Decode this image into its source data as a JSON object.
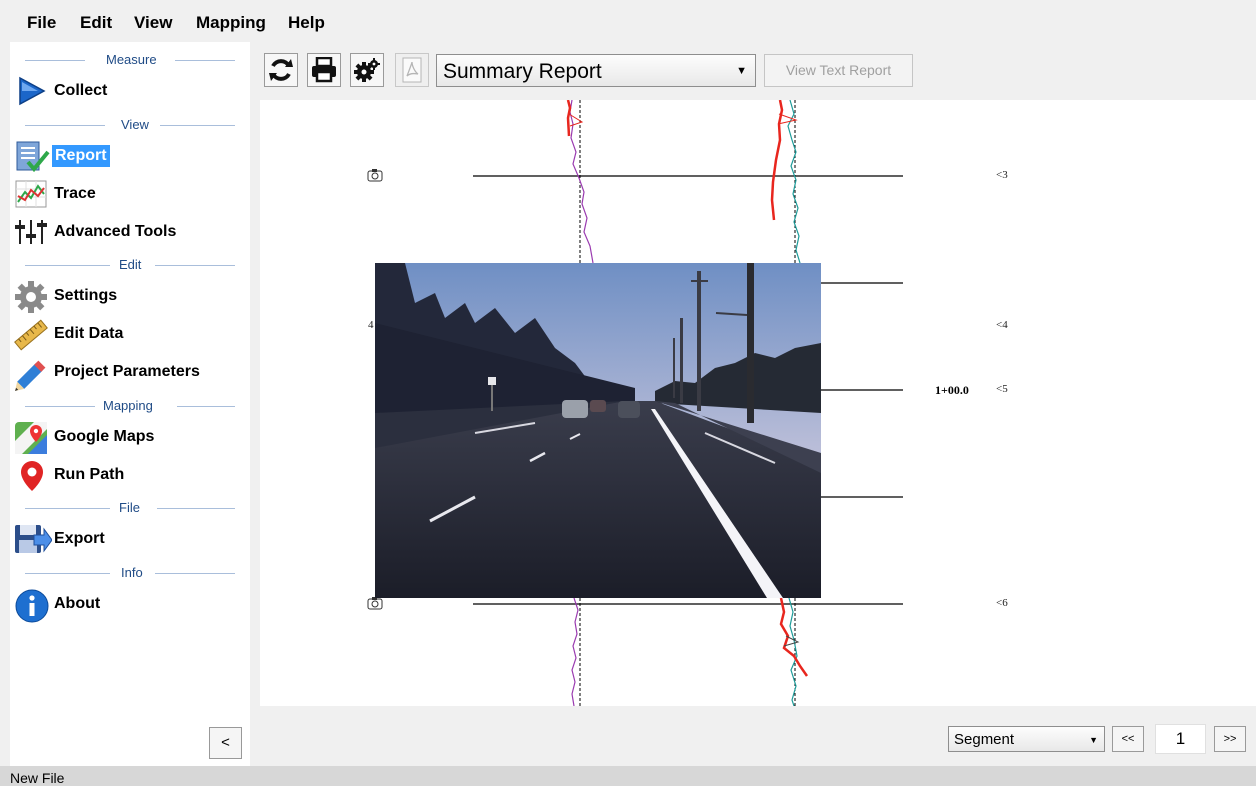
{
  "menu": [
    "File",
    "Edit",
    "View",
    "Mapping",
    "Help"
  ],
  "sidebar": {
    "sections": {
      "measure": "Measure",
      "view": "View",
      "edit": "Edit",
      "mapping": "Mapping",
      "file": "File",
      "info": "Info"
    },
    "items": {
      "collect": "Collect",
      "report": "Report",
      "trace": "Trace",
      "advanced_tools": "Advanced Tools",
      "settings": "Settings",
      "edit_data": "Edit Data",
      "project_parameters": "Project Parameters",
      "google_maps": "Google Maps",
      "run_path": "Run Path",
      "export": "Export",
      "about": "About"
    },
    "active_item": "Report",
    "collapse_label": "<"
  },
  "toolbar": {
    "report_type": "Summary Report",
    "view_text_report_label": "View Text Report",
    "icons": [
      "refresh-icon",
      "print-icon",
      "settings-gears-icon",
      "pdf-icon"
    ]
  },
  "report": {
    "markers": [
      "<3",
      "<4",
      "<5",
      "<6"
    ],
    "partial_marker": "4",
    "station_label": "1+00.0"
  },
  "footer": {
    "navigation_mode": "Segment",
    "prev_label": "<<",
    "next_label": ">>",
    "page": "1"
  },
  "status": "New File",
  "colors": {
    "active_highlight": "#3399ff",
    "section_text": "#1f4b86",
    "trace_red": "#e8261e",
    "trace_purple": "#9a3bb0",
    "trace_teal": "#1d9c9a"
  }
}
